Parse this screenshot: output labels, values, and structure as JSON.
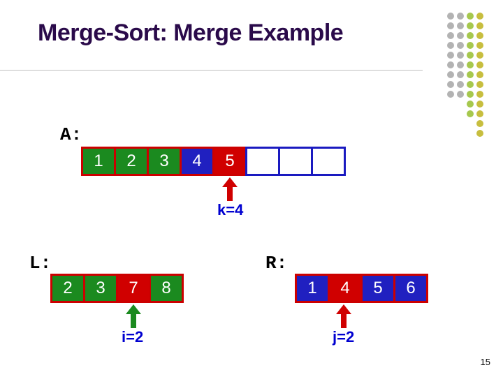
{
  "title": "Merge-Sort: Merge Example",
  "labels": {
    "A": "A:",
    "L": "L:",
    "R": "R:"
  },
  "A": {
    "cells": [
      "1",
      "2",
      "3",
      "4",
      "5",
      "",
      "",
      ""
    ]
  },
  "L": {
    "cells": [
      "2",
      "3",
      "7",
      "8"
    ]
  },
  "R": {
    "cells": [
      "1",
      "4",
      "5",
      "6"
    ]
  },
  "pointers": {
    "k": "k=4",
    "i": "i=2",
    "j": "j=2"
  },
  "slide_number": "15",
  "chart_data": {
    "type": "table",
    "title": "Merge-Sort: Merge Example",
    "arrays": {
      "A": [
        1,
        2,
        3,
        4,
        5,
        null,
        null,
        null
      ],
      "L": [
        2,
        3,
        7,
        8
      ],
      "R": [
        1,
        4,
        5,
        6
      ]
    },
    "highlights": {
      "A_last_written_index": 4,
      "A_last_written_value": 5,
      "L_current_index": 2,
      "L_current_value": 7,
      "R_current_index": 2,
      "R_current_value": 5
    },
    "indices": {
      "k": 4,
      "i": 2,
      "j": 2
    }
  }
}
